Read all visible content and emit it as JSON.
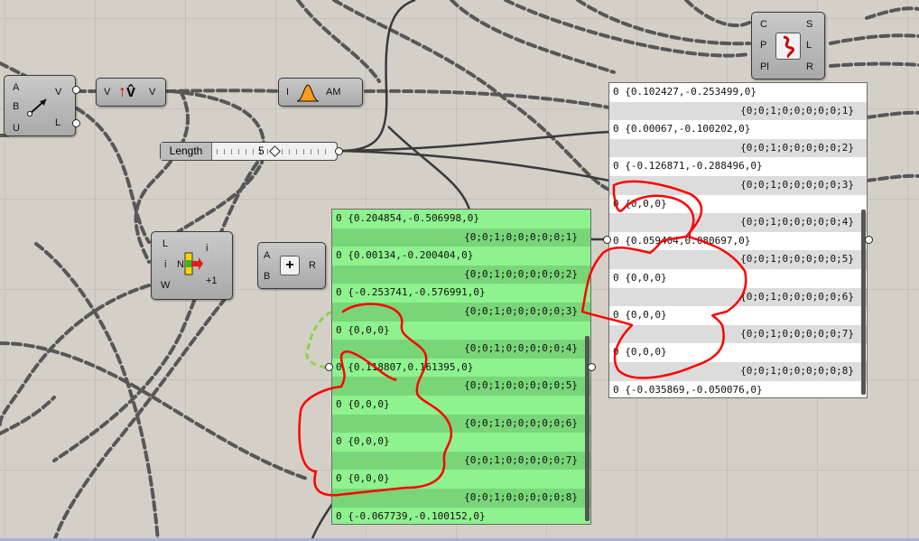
{
  "canvas": {
    "background": "#d4d0c8"
  },
  "components": {
    "vector2pt": {
      "inputs": [
        "A",
        "B",
        "U"
      ],
      "outputs": [
        "V",
        "L"
      ],
      "icon": "vector-2pt-icon"
    },
    "unit_vector": {
      "inputs": [
        "V"
      ],
      "outputs": [
        "V"
      ],
      "icon": "unit-vector-icon"
    },
    "amplitude": {
      "inputs": [
        "I"
      ],
      "outputs": [
        "AM"
      ],
      "icon": "amplitude-icon"
    },
    "curve_frames": {
      "inputs": [
        "C",
        "P",
        "Pl"
      ],
      "outputs": [
        "S",
        "L",
        "R"
      ],
      "icon": "curve-icon"
    },
    "list_item": {
      "inputs": [
        "L",
        "i",
        "W"
      ],
      "outputs": [
        "i",
        "+1"
      ],
      "center": "N",
      "icon": "list-item-icon"
    },
    "addition": {
      "inputs": [
        "A",
        "B"
      ],
      "outputs": [
        "R"
      ],
      "icon": "plus-icon"
    }
  },
  "slider": {
    "label": "Length",
    "value": "5"
  },
  "panel_green": {
    "rows": [
      "0 {0.204854,-0.506998,0}",
      "{0;0;1;0;0;0;0;0;1}",
      "0 {0.00134,-0.200404,0}",
      "{0;0;1;0;0;0;0;0;2}",
      "0 {-0.253741,-0.576991,0}",
      "{0;0;1;0;0;0;0;0;3}",
      "0 {0,0,0}",
      "{0;0;1;0;0;0;0;0;4}",
      "0 {0.118807,0.161395,0}",
      "{0;0;1;0;0;0;0;0;5}",
      "0 {0,0,0}",
      "{0;0;1;0;0;0;0;0;6}",
      "0 {0,0,0}",
      "{0;0;1;0;0;0;0;0;7}",
      "0 {0,0,0}",
      "{0;0;1;0;0;0;0;0;8}",
      "0 {-0.067739,-0.100152,0}"
    ]
  },
  "panel_white": {
    "rows": [
      "0 {0.102427,-0.253499,0}",
      "{0;0;1;0;0;0;0;0;1}",
      "0 {0.00067,-0.100202,0}",
      "{0;0;1;0;0;0;0;0;2}",
      "0 {-0.126871,-0.288496,0}",
      "{0;0;1;0;0;0;0;0;3}",
      "0 {0,0,0}",
      "{0;0;1;0;0;0;0;0;4}",
      "0 {0.059404,0.080697,0}",
      "{0;0;1;0;0;0;0;0;5}",
      "0 {0,0,0}",
      "{0;0;1;0;0;0;0;0;6}",
      "0 {0,0,0}",
      "{0;0;1;0;0;0;0;0;7}",
      "0 {0,0,0}",
      "{0;0;1;0;0;0;0;0;8}",
      "0 {-0.035869,-0.050076,0}"
    ]
  },
  "colors": {
    "panel_green": "#8ef28e",
    "panel_white": "#ffffff",
    "annotation": "#ff0000",
    "wire": "#4a4a4a"
  }
}
